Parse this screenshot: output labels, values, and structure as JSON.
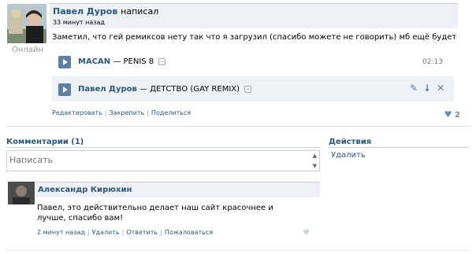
{
  "post": {
    "author": "Павел Дуров",
    "action": "написал",
    "time": "33 минут назад",
    "online": "Онлайн",
    "text": "Заметил, что гей ремиксов нету так что я загрузил (спасибо можете не говорить) мб ещё будет",
    "tracks": [
      {
        "artist": "MACAN",
        "title": "— PENIS 8",
        "duration": "02:13"
      },
      {
        "artist": "Павел Дуров",
        "title": "— ДЕТСТВО (GAY REMIX)",
        "duration": ""
      }
    ],
    "links": [
      "Редактировать",
      "Закрепить",
      "Поделиться"
    ],
    "likes": "2"
  },
  "comments": {
    "title": "Комментарии (1)",
    "input_placeholder": "Написать",
    "items": [
      {
        "author": "Александр Кирюхин",
        "text": "Павел, это действительно делает наш сайт красочнее и лучше, спасибо вам!",
        "time": "2 минут назад",
        "links": [
          "Удалить",
          "Ответить",
          "Пожаловаться"
        ]
      }
    ]
  },
  "actions": {
    "title": "Действия",
    "delete": "Удалить"
  },
  "colors": {
    "link": "#2b587a",
    "header_bg": "#edf1f5",
    "play": "#5b7fa6"
  }
}
